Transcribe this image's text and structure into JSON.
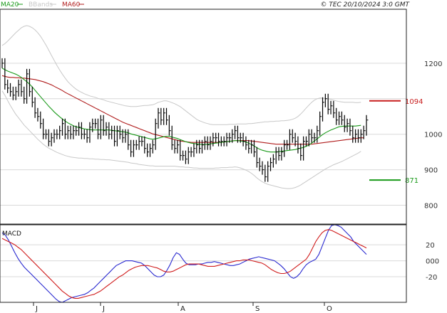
{
  "chart_data": [
    {
      "type": "line",
      "panel": "price",
      "title": "",
      "legend": [
        {
          "name": "MA20",
          "color": "#1a9a1a"
        },
        {
          "name": "BBands",
          "color": "#c8c8c8"
        },
        {
          "name": "MA60",
          "color": "#b01c1c"
        }
      ],
      "copyright": "© TEC 20/10/2024 3:0 GMT",
      "ylim": [
        747,
        1352
      ],
      "yticks": [
        800,
        900,
        1000,
        1200
      ],
      "x_month_labels": [
        "J",
        "J",
        "A",
        "S",
        "O"
      ],
      "grid": true,
      "levels": [
        {
          "label": "1094",
          "value": 1094,
          "color": "#c81e1e"
        },
        {
          "label": "871",
          "value": 871,
          "color": "#1a9a1a"
        }
      ],
      "bars": [
        1200,
        1140,
        1130,
        1120,
        1110,
        1120,
        1140,
        1120,
        1100,
        1170,
        1120,
        1090,
        1060,
        1050,
        1030,
        1000,
        1000,
        980,
        990,
        1000,
        1000,
        1010,
        1030,
        1000,
        1010,
        1000,
        1010,
        1010,
        1020,
        1000,
        1000,
        990,
        1020,
        1030,
        1030,
        1000,
        1040,
        1010,
        1020,
        1000,
        1010,
        980,
        1010,
        1000,
        990,
        1000,
        970,
        950,
        970,
        970,
        980,
        980,
        960,
        950,
        960,
        970,
        1030,
        1060,
        1040,
        1060,
        1040,
        1010,
        970,
        960,
        970,
        940,
        940,
        930,
        950,
        950,
        960,
        970,
        960,
        970,
        980,
        970,
        980,
        990,
        990,
        980,
        980,
        980,
        990,
        990,
        1000,
        1010,
        990,
        990,
        980,
        970,
        960,
        970,
        950,
        920,
        910,
        900,
        880,
        910,
        920,
        930,
        950,
        940,
        950,
        970,
        970,
        1000,
        990,
        980,
        960,
        940,
        980,
        980,
        1000,
        990,
        990,
        1010,
        1050,
        1090,
        1100,
        1070,
        1080,
        1060,
        1040,
        1050,
        1040,
        1020,
        1030,
        1010,
        990,
        1000,
        990,
        1000,
        1010,
        1040
      ],
      "ma20": [
        1186,
        1182,
        1178,
        1175,
        1172,
        1169,
        1165,
        1160,
        1154,
        1148,
        1141,
        1133,
        1124,
        1115,
        1106,
        1097,
        1088,
        1079,
        1071,
        1063,
        1056,
        1049,
        1043,
        1037,
        1032,
        1028,
        1024,
        1021,
        1019,
        1017,
        1015,
        1014,
        1013,
        1012,
        1012,
        1012,
        1012,
        1012,
        1012,
        1012,
        1011,
        1010,
        1009,
        1008,
        1007,
        1006,
        1004,
        1001,
        999,
        997,
        995,
        993,
        991,
        989,
        987,
        986,
        987,
        989,
        991,
        993,
        994,
        994,
        992,
        990,
        988,
        985,
        982,
        979,
        977,
        975,
        974,
        973,
        972,
        971,
        971,
        972,
        973,
        974,
        975,
        976,
        977,
        978,
        979,
        980,
        981,
        982,
        982,
        981,
        980,
        978,
        975,
        971,
        967,
        962,
        958,
        955,
        953,
        951,
        950,
        950,
        950,
        951,
        952,
        953,
        954,
        955,
        956,
        957,
        959,
        961,
        963,
        966,
        970,
        975,
        981,
        987,
        993,
        999,
        1004,
        1008,
        1012,
        1015,
        1018,
        1021,
        1022,
        1023,
        1023,
        1023,
        1023,
        1023,
        1024,
        1025
      ],
      "ma60": [
        1165,
        1163,
        1161,
        1160,
        1160,
        1159,
        1159,
        1158,
        1158,
        1157,
        1156,
        1155,
        1154,
        1152,
        1150,
        1148,
        1145,
        1142,
        1139,
        1135,
        1131,
        1127,
        1123,
        1118,
        1114,
        1110,
        1106,
        1102,
        1098,
        1094,
        1090,
        1086,
        1082,
        1078,
        1074,
        1070,
        1066,
        1062,
        1058,
        1054,
        1050,
        1046,
        1042,
        1038,
        1034,
        1031,
        1028,
        1025,
        1022,
        1019,
        1016,
        1013,
        1010,
        1007,
        1004,
        1001,
        999,
        997,
        995,
        993,
        991,
        989,
        987,
        985,
        983,
        981,
        980,
        979,
        978,
        977,
        977,
        977,
        977,
        977,
        977,
        977,
        977,
        977,
        977,
        977,
        977,
        978,
        979,
        980,
        981,
        982,
        982,
        982,
        982,
        982,
        982,
        981,
        980,
        979,
        978,
        977,
        976,
        975,
        974,
        973,
        972,
        972,
        972,
        972,
        972,
        972,
        972,
        972,
        972,
        972,
        972,
        972,
        972,
        972,
        973,
        974,
        975,
        976,
        977,
        978,
        979,
        980,
        981,
        982,
        983,
        984,
        985,
        986,
        987,
        988,
        989,
        990,
        990
      ],
      "bb_upper": [
        1250,
        1255,
        1262,
        1270,
        1278,
        1286,
        1293,
        1300,
        1304,
        1306,
        1304,
        1300,
        1294,
        1286,
        1276,
        1264,
        1251,
        1237,
        1222,
        1208,
        1194,
        1181,
        1169,
        1158,
        1148,
        1140,
        1133,
        1127,
        1122,
        1118,
        1114,
        1111,
        1108,
        1106,
        1104,
        1101,
        1099,
        1097,
        1094,
        1092,
        1090,
        1088,
        1086,
        1084,
        1082,
        1080,
        1079,
        1078,
        1078,
        1078,
        1079,
        1080,
        1081,
        1081,
        1082,
        1083,
        1086,
        1090,
        1092,
        1094,
        1094,
        1092,
        1089,
        1086,
        1082,
        1078,
        1072,
        1066,
        1060,
        1054,
        1048,
        1042,
        1038,
        1035,
        1032,
        1030,
        1028,
        1027,
        1027,
        1027,
        1027,
        1027,
        1027,
        1028,
        1028,
        1028,
        1029,
        1029,
        1029,
        1029,
        1030,
        1030,
        1031,
        1032,
        1033,
        1034,
        1035,
        1035,
        1036,
        1036,
        1037,
        1037,
        1038,
        1038,
        1039,
        1040,
        1042,
        1045,
        1050,
        1057,
        1065,
        1074,
        1082,
        1090,
        1096,
        1100,
        1102,
        1102,
        1101,
        1100,
        1098,
        1096,
        1094,
        1092,
        1091,
        1090,
        1090,
        1090,
        1090,
        1089,
        1089,
        1090
      ],
      "bb_lower": [
        1122,
        1110,
        1095,
        1081,
        1068,
        1056,
        1046,
        1036,
        1026,
        1018,
        1010,
        1002,
        994,
        986,
        979,
        972,
        966,
        961,
        957,
        953,
        949,
        946,
        943,
        940,
        938,
        936,
        935,
        934,
        933,
        933,
        932,
        932,
        931,
        931,
        930,
        930,
        929,
        929,
        928,
        928,
        927,
        926,
        925,
        924,
        923,
        922,
        921,
        919,
        918,
        917,
        915,
        914,
        913,
        912,
        911,
        911,
        910,
        910,
        910,
        910,
        910,
        910,
        910,
        910,
        909,
        908,
        908,
        907,
        907,
        906,
        905,
        905,
        904,
        904,
        904,
        904,
        904,
        904,
        905,
        905,
        906,
        906,
        906,
        907,
        907,
        908,
        907,
        905,
        902,
        899,
        895,
        890,
        884,
        877,
        871,
        866,
        862,
        859,
        857,
        855,
        853,
        851,
        849,
        848,
        847,
        847,
        848,
        850,
        853,
        857,
        862,
        867,
        872,
        877,
        882,
        887,
        892,
        897,
        902,
        906,
        910,
        914,
        917,
        920,
        923,
        927,
        931,
        935,
        939,
        943,
        947,
        952
      ],
      "macd_ylim": [
        -52,
        45
      ],
      "macd_yticks": [
        -20,
        0,
        20
      ],
      "macd_yticks_text": [
        "-20",
        "000",
        "20"
      ],
      "macd": [
        35,
        32,
        26,
        18,
        10,
        3,
        -3,
        -8,
        -12,
        -16,
        -20,
        -24,
        -28,
        -32,
        -36,
        -40,
        -44,
        -48,
        -51,
        -52,
        -50,
        -48,
        -46,
        -45,
        -44,
        -43,
        -42,
        -40,
        -37,
        -34,
        -30,
        -26,
        -22,
        -18,
        -14,
        -10,
        -6,
        -4,
        -2,
        0,
        0,
        0,
        -1,
        -2,
        -3,
        -6,
        -10,
        -14,
        -18,
        -20,
        -20,
        -18,
        -12,
        -5,
        4,
        10,
        8,
        2,
        -3,
        -5,
        -5,
        -5,
        -4,
        -4,
        -3,
        -2,
        -2,
        -1,
        -2,
        -3,
        -4,
        -5,
        -6,
        -6,
        -5,
        -4,
        -2,
        0,
        2,
        3,
        4,
        5,
        4,
        3,
        2,
        1,
        0,
        -3,
        -6,
        -10,
        -15,
        -20,
        -22,
        -20,
        -16,
        -10,
        -5,
        -2,
        0,
        2,
        8,
        18,
        28,
        38,
        44,
        45,
        44,
        42,
        38,
        34,
        30,
        24,
        20,
        16,
        12,
        8
      ],
      "macd_signal": [
        28,
        26,
        24,
        22,
        20,
        17,
        14,
        10,
        6,
        2,
        -2,
        -6,
        -10,
        -14,
        -18,
        -22,
        -26,
        -30,
        -34,
        -38,
        -41,
        -44,
        -46,
        -47,
        -47,
        -46,
        -45,
        -44,
        -43,
        -42,
        -40,
        -38,
        -35,
        -32,
        -29,
        -26,
        -23,
        -20,
        -18,
        -15,
        -12,
        -10,
        -8,
        -7,
        -6,
        -6,
        -6,
        -7,
        -8,
        -9,
        -11,
        -13,
        -14,
        -14,
        -13,
        -11,
        -9,
        -7,
        -5,
        -4,
        -4,
        -4,
        -4,
        -5,
        -6,
        -7,
        -7,
        -7,
        -6,
        -5,
        -4,
        -3,
        -2,
        -1,
        0,
        0,
        1,
        1,
        1,
        0,
        -1,
        -2,
        -3,
        -5,
        -8,
        -11,
        -13,
        -15,
        -16,
        -16,
        -15,
        -13,
        -10,
        -7,
        -4,
        -1,
        2,
        8,
        16,
        24,
        30,
        35,
        38,
        39,
        38,
        36,
        34,
        32,
        30,
        28,
        26,
        24,
        22,
        20,
        18,
        16
      ]
    }
  ],
  "macd_title": "MACD",
  "colors": {
    "ma20": "#1a9a1a",
    "ma60": "#b01c1c",
    "bbands": "#c8c8c8",
    "bars": "#000000",
    "macd": "#2a2ad0",
    "macd_signal": "#d01c1c"
  }
}
